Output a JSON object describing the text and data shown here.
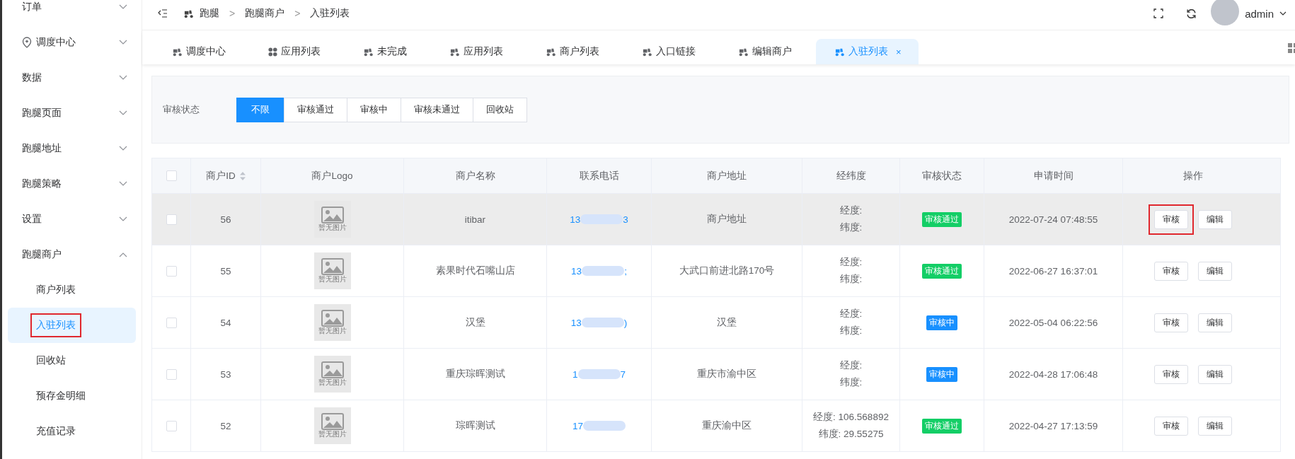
{
  "sidebar": {
    "items": [
      {
        "label": "订单",
        "icon": false,
        "expanded": false
      },
      {
        "label": "调度中心",
        "icon": true,
        "expanded": false
      },
      {
        "label": "数据",
        "icon": false,
        "expanded": false
      },
      {
        "label": "跑腿页面",
        "icon": false,
        "expanded": false
      },
      {
        "label": "跑腿地址",
        "icon": false,
        "expanded": false
      },
      {
        "label": "跑腿策略",
        "icon": false,
        "expanded": false
      },
      {
        "label": "设置",
        "icon": false,
        "expanded": false
      },
      {
        "label": "跑腿商户",
        "icon": false,
        "expanded": true,
        "children": [
          {
            "label": "商户列表",
            "selected": false,
            "highlighted": false
          },
          {
            "label": "入驻列表",
            "selected": true,
            "highlighted": true
          },
          {
            "label": "回收站",
            "selected": false,
            "highlighted": false
          },
          {
            "label": "预存金明细",
            "selected": false,
            "highlighted": false
          },
          {
            "label": "充值记录",
            "selected": false,
            "highlighted": false
          }
        ]
      }
    ]
  },
  "breadcrumb": [
    {
      "label": "跑腿"
    },
    {
      "separator": ">",
      "label": "跑腿商户"
    },
    {
      "separator": ">",
      "label": "入驻列表"
    }
  ],
  "user": {
    "name": "admin"
  },
  "tabs": [
    {
      "label": "调度中心",
      "kind": "scooter",
      "selected": false
    },
    {
      "label": "应用列表",
      "kind": "dots",
      "selected": false
    },
    {
      "label": "未完成",
      "kind": "scooter",
      "selected": false
    },
    {
      "label": "应用列表",
      "kind": "scooter",
      "selected": false
    },
    {
      "label": "商户列表",
      "kind": "scooter",
      "selected": false
    },
    {
      "label": "入口链接",
      "kind": "scooter",
      "selected": false
    },
    {
      "label": "编辑商户",
      "kind": "scooter",
      "selected": false
    },
    {
      "label": "入驻列表",
      "kind": "scooter",
      "selected": true,
      "close": "×"
    }
  ],
  "filter": {
    "label": "审核状态",
    "options": [
      {
        "label": "不限",
        "selected": true
      },
      {
        "label": "审核通过",
        "selected": false
      },
      {
        "label": "审核中",
        "selected": false
      },
      {
        "label": "审核未通过",
        "selected": false
      },
      {
        "label": "回收站",
        "selected": false
      }
    ]
  },
  "table": {
    "all_checked": false,
    "columns": [
      "商户ID",
      "商户Logo",
      "商户名称",
      "联系电话",
      "商户地址",
      "经纬度",
      "审核状态",
      "申请时间",
      "操作"
    ],
    "rows": [
      {
        "checked": false,
        "hovered": true,
        "id": "56",
        "logo_text": "暂无图片",
        "name": "itibar",
        "phone_start": "13",
        "phone_end": "3",
        "address": "商户地址",
        "lng": "经度:",
        "lat": "纬度:",
        "status": {
          "kind": "passed",
          "label": "审核通过"
        },
        "time": "2022-07-24 07:48:55",
        "actions": [
          {
            "label": "审核",
            "highlighted": true
          },
          {
            "label": "编辑",
            "highlighted": false
          }
        ]
      },
      {
        "checked": false,
        "hovered": false,
        "id": "55",
        "logo_text": "暂无图片",
        "name": "素果时代石嘴山店",
        "phone_start": "13",
        "phone_end": ";",
        "address": "大武口前进北路170号",
        "lng": "经度:",
        "lat": "纬度:",
        "status": {
          "kind": "passed",
          "label": "审核通过"
        },
        "time": "2022-06-27 16:37:01",
        "actions": [
          {
            "label": "审核",
            "highlighted": false
          },
          {
            "label": "编辑",
            "highlighted": false
          }
        ]
      },
      {
        "checked": false,
        "hovered": false,
        "id": "54",
        "logo_text": "暂无图片",
        "name": "汉堡",
        "phone_start": "13",
        "phone_end": ")",
        "address": "汉堡",
        "lng": "经度:",
        "lat": "纬度:",
        "status": {
          "kind": "reviewing",
          "label": "审核中"
        },
        "time": "2022-05-04 06:22:56",
        "actions": [
          {
            "label": "审核",
            "highlighted": false
          },
          {
            "label": "编辑",
            "highlighted": false
          }
        ]
      },
      {
        "checked": false,
        "hovered": false,
        "id": "53",
        "logo_text": "暂无图片",
        "name": "重庆琮晖测试",
        "phone_start": "1",
        "phone_end": "7",
        "address": "重庆市渝中区",
        "lng": "经度:",
        "lat": "纬度:",
        "status": {
          "kind": "reviewing",
          "label": "审核中"
        },
        "time": "2022-04-28 17:06:48",
        "actions": [
          {
            "label": "审核",
            "highlighted": false
          },
          {
            "label": "编辑",
            "highlighted": false
          }
        ]
      },
      {
        "checked": false,
        "hovered": false,
        "id": "52",
        "logo_text": "暂无图片",
        "name": "琮晖测试",
        "phone_start": "17",
        "address": "重庆渝中区",
        "lng": "经度: 106.568892",
        "lat": "纬度: 29.55275",
        "status": {
          "kind": "passed",
          "label": "审核通过"
        },
        "time": "2022-04-27 17:13:59",
        "actions": [
          {
            "label": "审核",
            "highlighted": false
          },
          {
            "label": "编辑",
            "highlighted": false
          }
        ]
      }
    ]
  }
}
